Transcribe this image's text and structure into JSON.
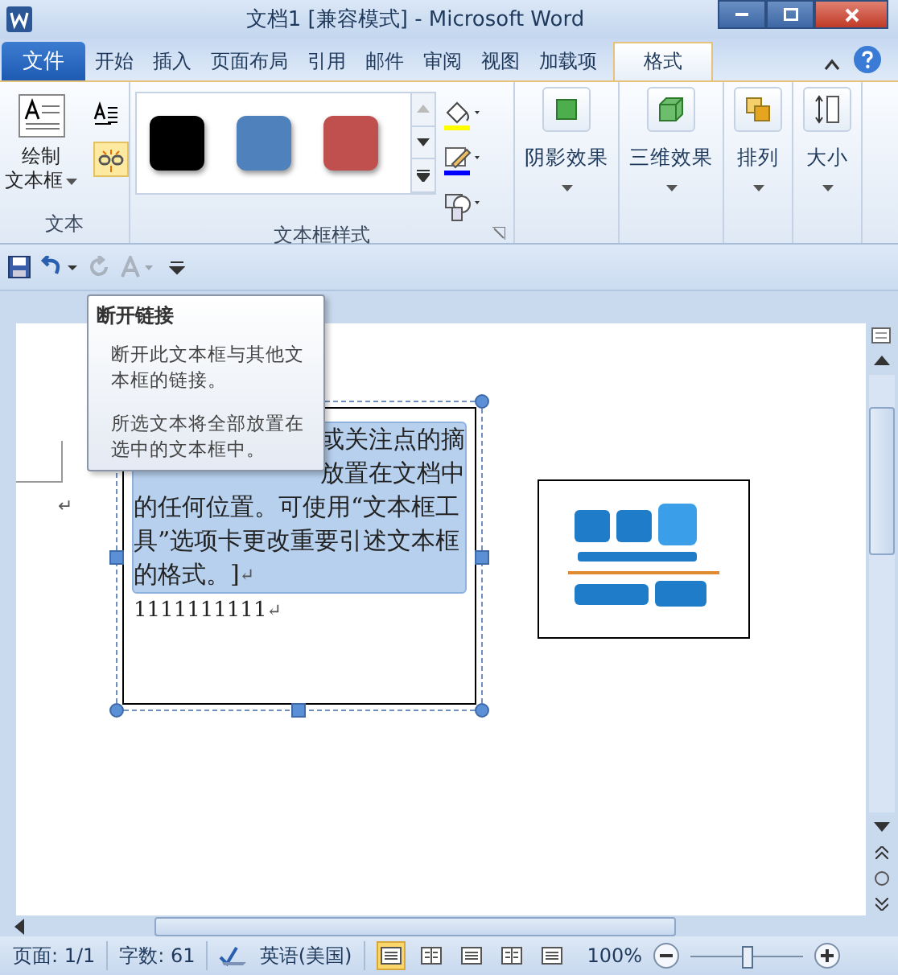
{
  "window": {
    "title": "文档1 [兼容模式] - Microsoft Word"
  },
  "file_tab": {
    "label": "文件"
  },
  "tabs": [
    {
      "label": "开始",
      "selected": false
    },
    {
      "label": "插入",
      "selected": false
    },
    {
      "label": "页面布局",
      "selected": false
    },
    {
      "label": "引用",
      "selected": false
    },
    {
      "label": "邮件",
      "selected": false
    },
    {
      "label": "审阅",
      "selected": false
    },
    {
      "label": "视图",
      "selected": false
    },
    {
      "label": "加载项",
      "selected": false
    },
    {
      "label": "格式",
      "selected": true
    }
  ],
  "ribbon": {
    "text_group": {
      "label": "文本",
      "draw_button": {
        "lines": [
          "绘制",
          "文本框"
        ]
      },
      "break_link": {
        "highlighted": true
      }
    },
    "styles_group": {
      "label": "文本框样式",
      "swatches": [
        {
          "color": "#000000"
        },
        {
          "color": "#4f81bd"
        },
        {
          "color": "#c0504d"
        }
      ]
    },
    "big_buttons": [
      {
        "label": "阴影效果",
        "kind": "shadow"
      },
      {
        "label": "三维效果",
        "kind": "threed"
      },
      {
        "label": "排列",
        "kind": "arrange"
      },
      {
        "label": "大小",
        "kind": "size"
      }
    ]
  },
  "quick_access": [
    {
      "kind": "save",
      "disabled": false
    },
    {
      "kind": "undo",
      "disabled": false
    },
    {
      "kind": "redo",
      "disabled": true
    },
    {
      "kind": "font_color",
      "disabled": true
    },
    {
      "kind": "customize",
      "disabled": false
    }
  ],
  "tooltip": {
    "title": "断开链接",
    "paragraphs": [
      "断开此文本框与其他文本框的链接。",
      "所选文本将全部放置在选中的文本框中。"
    ]
  },
  "document": {
    "margin_mark": "↵",
    "text_box": {
      "lines": [
        {
          "text": "或关注点的摘",
          "kind": "tail"
        },
        {
          "text": "放置在文档中",
          "kind": "tail"
        },
        {
          "text": "的任何位置。可使用“文本框工",
          "kind": "full"
        },
        {
          "text": "具”选项卡更改重要引述文本框",
          "kind": "full"
        },
        {
          "text": "的格式。]",
          "kind": "full",
          "mark": "↵"
        }
      ],
      "after": {
        "text": "1111111111",
        "mark": "↵"
      }
    }
  },
  "status_bar": {
    "page": "页面: 1/1",
    "words": "字数: 61",
    "language": "英语(美国)",
    "views": [
      {
        "selected": true
      },
      {
        "selected": false
      },
      {
        "selected": false
      },
      {
        "selected": false
      },
      {
        "selected": false
      }
    ],
    "zoom": "100%",
    "zoom_slider": {
      "level": 0.5
    }
  }
}
